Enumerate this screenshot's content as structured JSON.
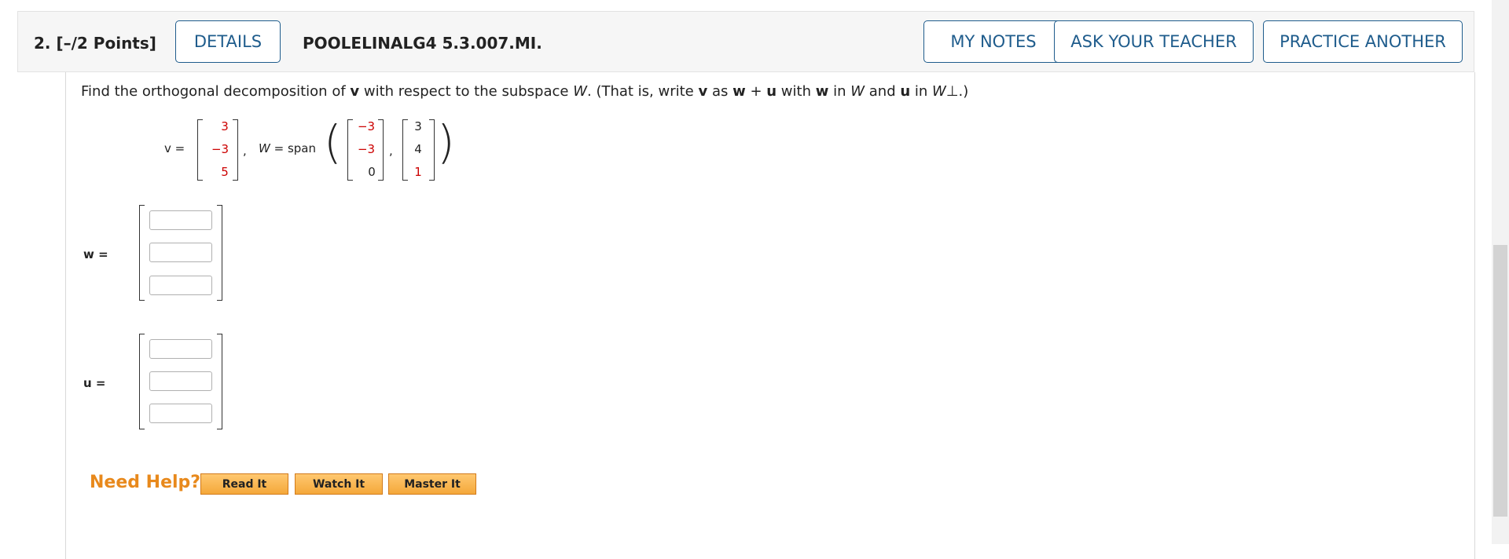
{
  "header": {
    "question_number": "2.",
    "points": "[–/2 Points]",
    "details_label": "DETAILS",
    "question_code": "POOLELINALG4 5.3.007.MI.",
    "my_notes_label": "MY NOTES",
    "ask_teacher_label": "ASK YOUR TEACHER",
    "practice_another_label": "PRACTICE ANOTHER"
  },
  "question": {
    "prompt_parts": {
      "p1": "Find the orthogonal decomposition of ",
      "v": "v",
      "p2": " with respect to the subspace ",
      "W": "W",
      "p3": ". (That is, write ",
      "v2": "v",
      "p4": " as ",
      "w": "w",
      "plus": " + ",
      "u": "u",
      "p5": " with ",
      "w2": "w",
      "p6": " in ",
      "W2": "W",
      "p7": " and ",
      "u2": "u",
      "p8": " in ",
      "Wperp": "W⊥",
      "p9": ".)"
    },
    "v_label": "v =",
    "v_vector": [
      "3",
      "−3",
      "5"
    ],
    "comma": ",",
    "W_label": "W = span",
    "basis1": [
      "−3",
      "−3",
      "0"
    ],
    "basis2": [
      "3",
      "4",
      "1"
    ],
    "w_label": "w =",
    "u_label": "u =",
    "w_answers": [
      "",
      "",
      ""
    ],
    "u_answers": [
      "",
      "",
      ""
    ]
  },
  "help": {
    "need_help": "Need Help?",
    "read_it": "Read It",
    "watch_it": "Watch It",
    "master_it": "Master It"
  },
  "colors": {
    "accent": "#1f5c8c",
    "red_value": "#cc0000",
    "help_orange": "#e8891c"
  }
}
